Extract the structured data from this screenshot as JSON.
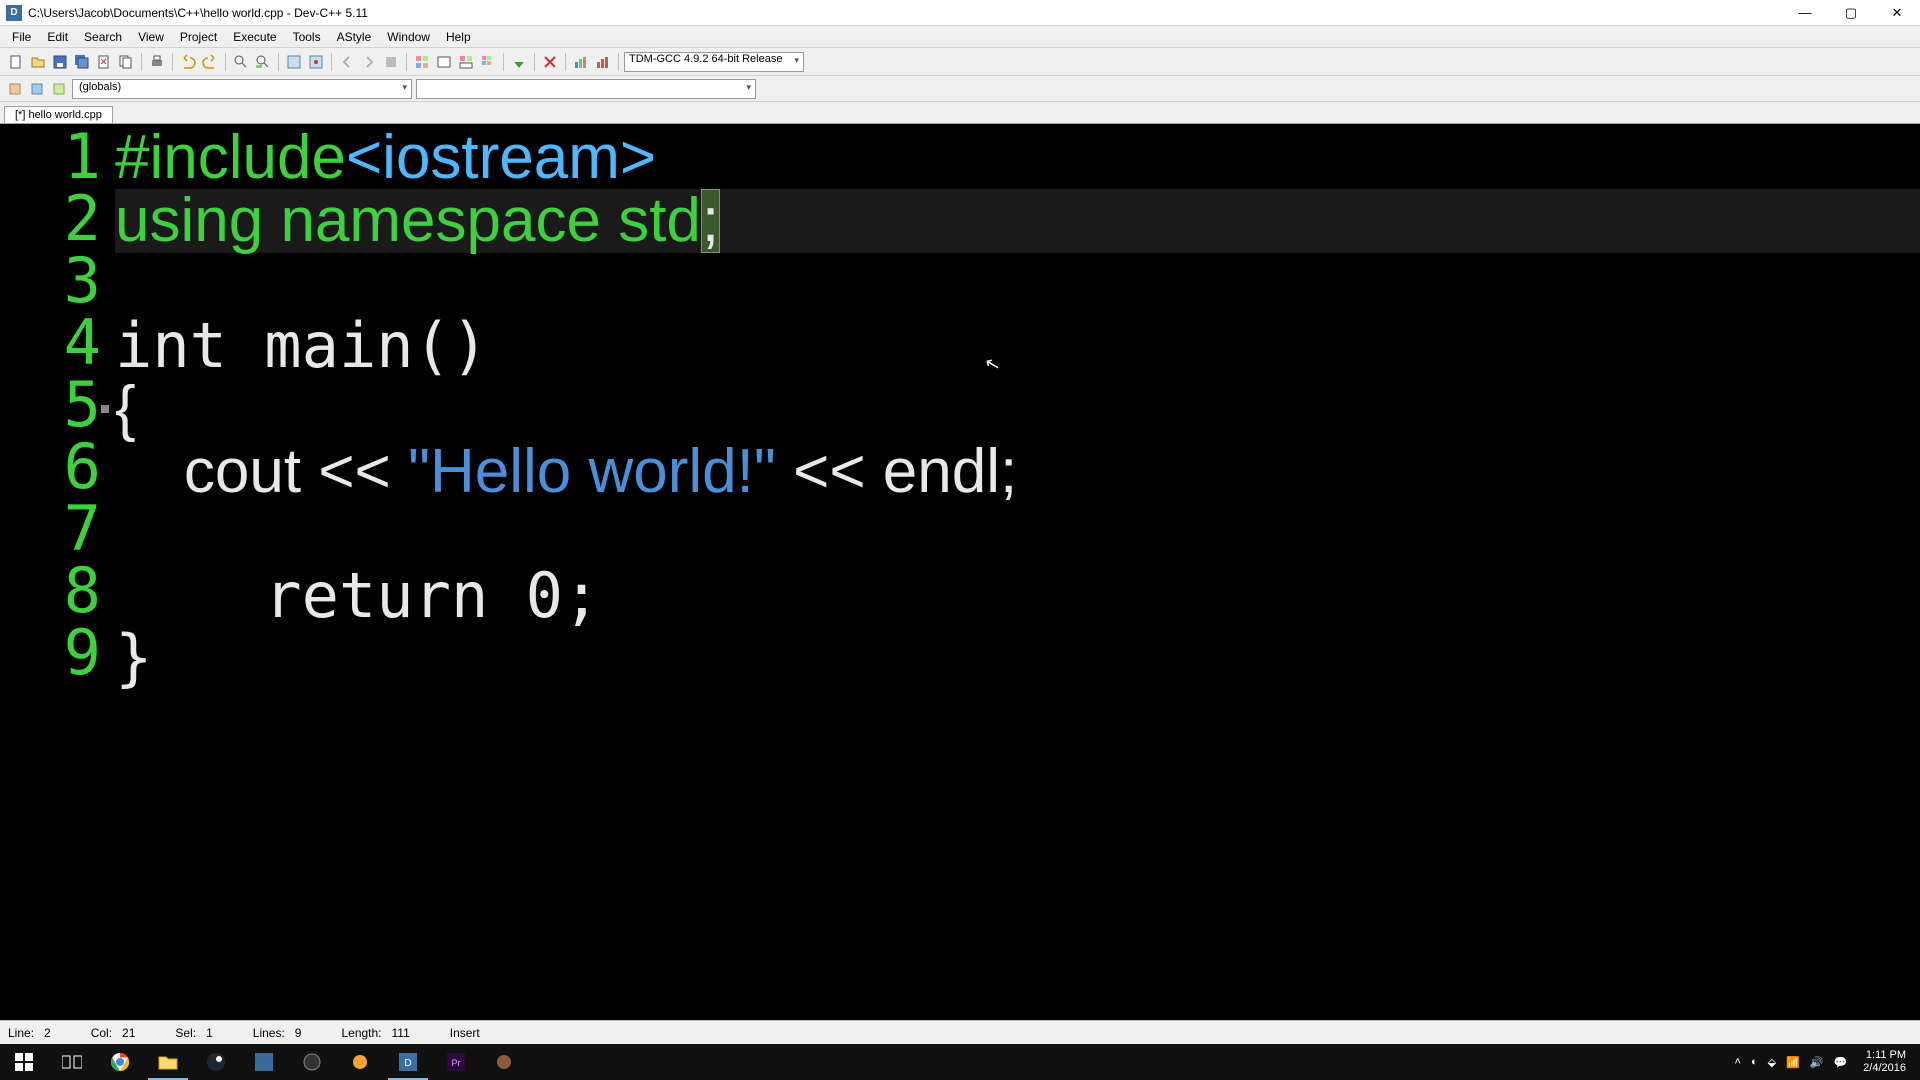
{
  "window": {
    "title": "C:\\Users\\Jacob\\Documents\\C++\\hello world.cpp - Dev-C++ 5.11",
    "app_icon_text": "D"
  },
  "menu": [
    "File",
    "Edit",
    "Search",
    "View",
    "Project",
    "Execute",
    "Tools",
    "AStyle",
    "Window",
    "Help"
  ],
  "toolbar": {
    "compiler_combo": "TDM-GCC 4.9.2 64-bit Release"
  },
  "toolbar2": {
    "scope_combo": "(globals)",
    "member_combo": ""
  },
  "tab": {
    "label": "[*] hello world.cpp"
  },
  "code": {
    "lines": [
      "1",
      "2",
      "3",
      "4",
      "5",
      "6",
      "7",
      "8",
      "9"
    ],
    "l1_pre": "#include",
    "l1_inc": "<iostream>",
    "l2_a": "using namespace std",
    "l2_semi": ";",
    "l4": "int main()",
    "l5": "{",
    "l6_a": "    cout << ",
    "l6_str": "\"Hello world!\"",
    "l6_b": " << endl;",
    "l8": "    return 0;",
    "l9": "}"
  },
  "status": {
    "line": "Line:   2",
    "col": "Col:   21",
    "sel": "Sel:   1",
    "lines": "Lines:   9",
    "length": "Length:   111",
    "mode": "Insert"
  },
  "tray": {
    "time": "1:11 PM",
    "date": "2/4/2016"
  },
  "icons": {
    "min": "—",
    "max": "▢",
    "close": "✕",
    "chevup": "˄"
  }
}
